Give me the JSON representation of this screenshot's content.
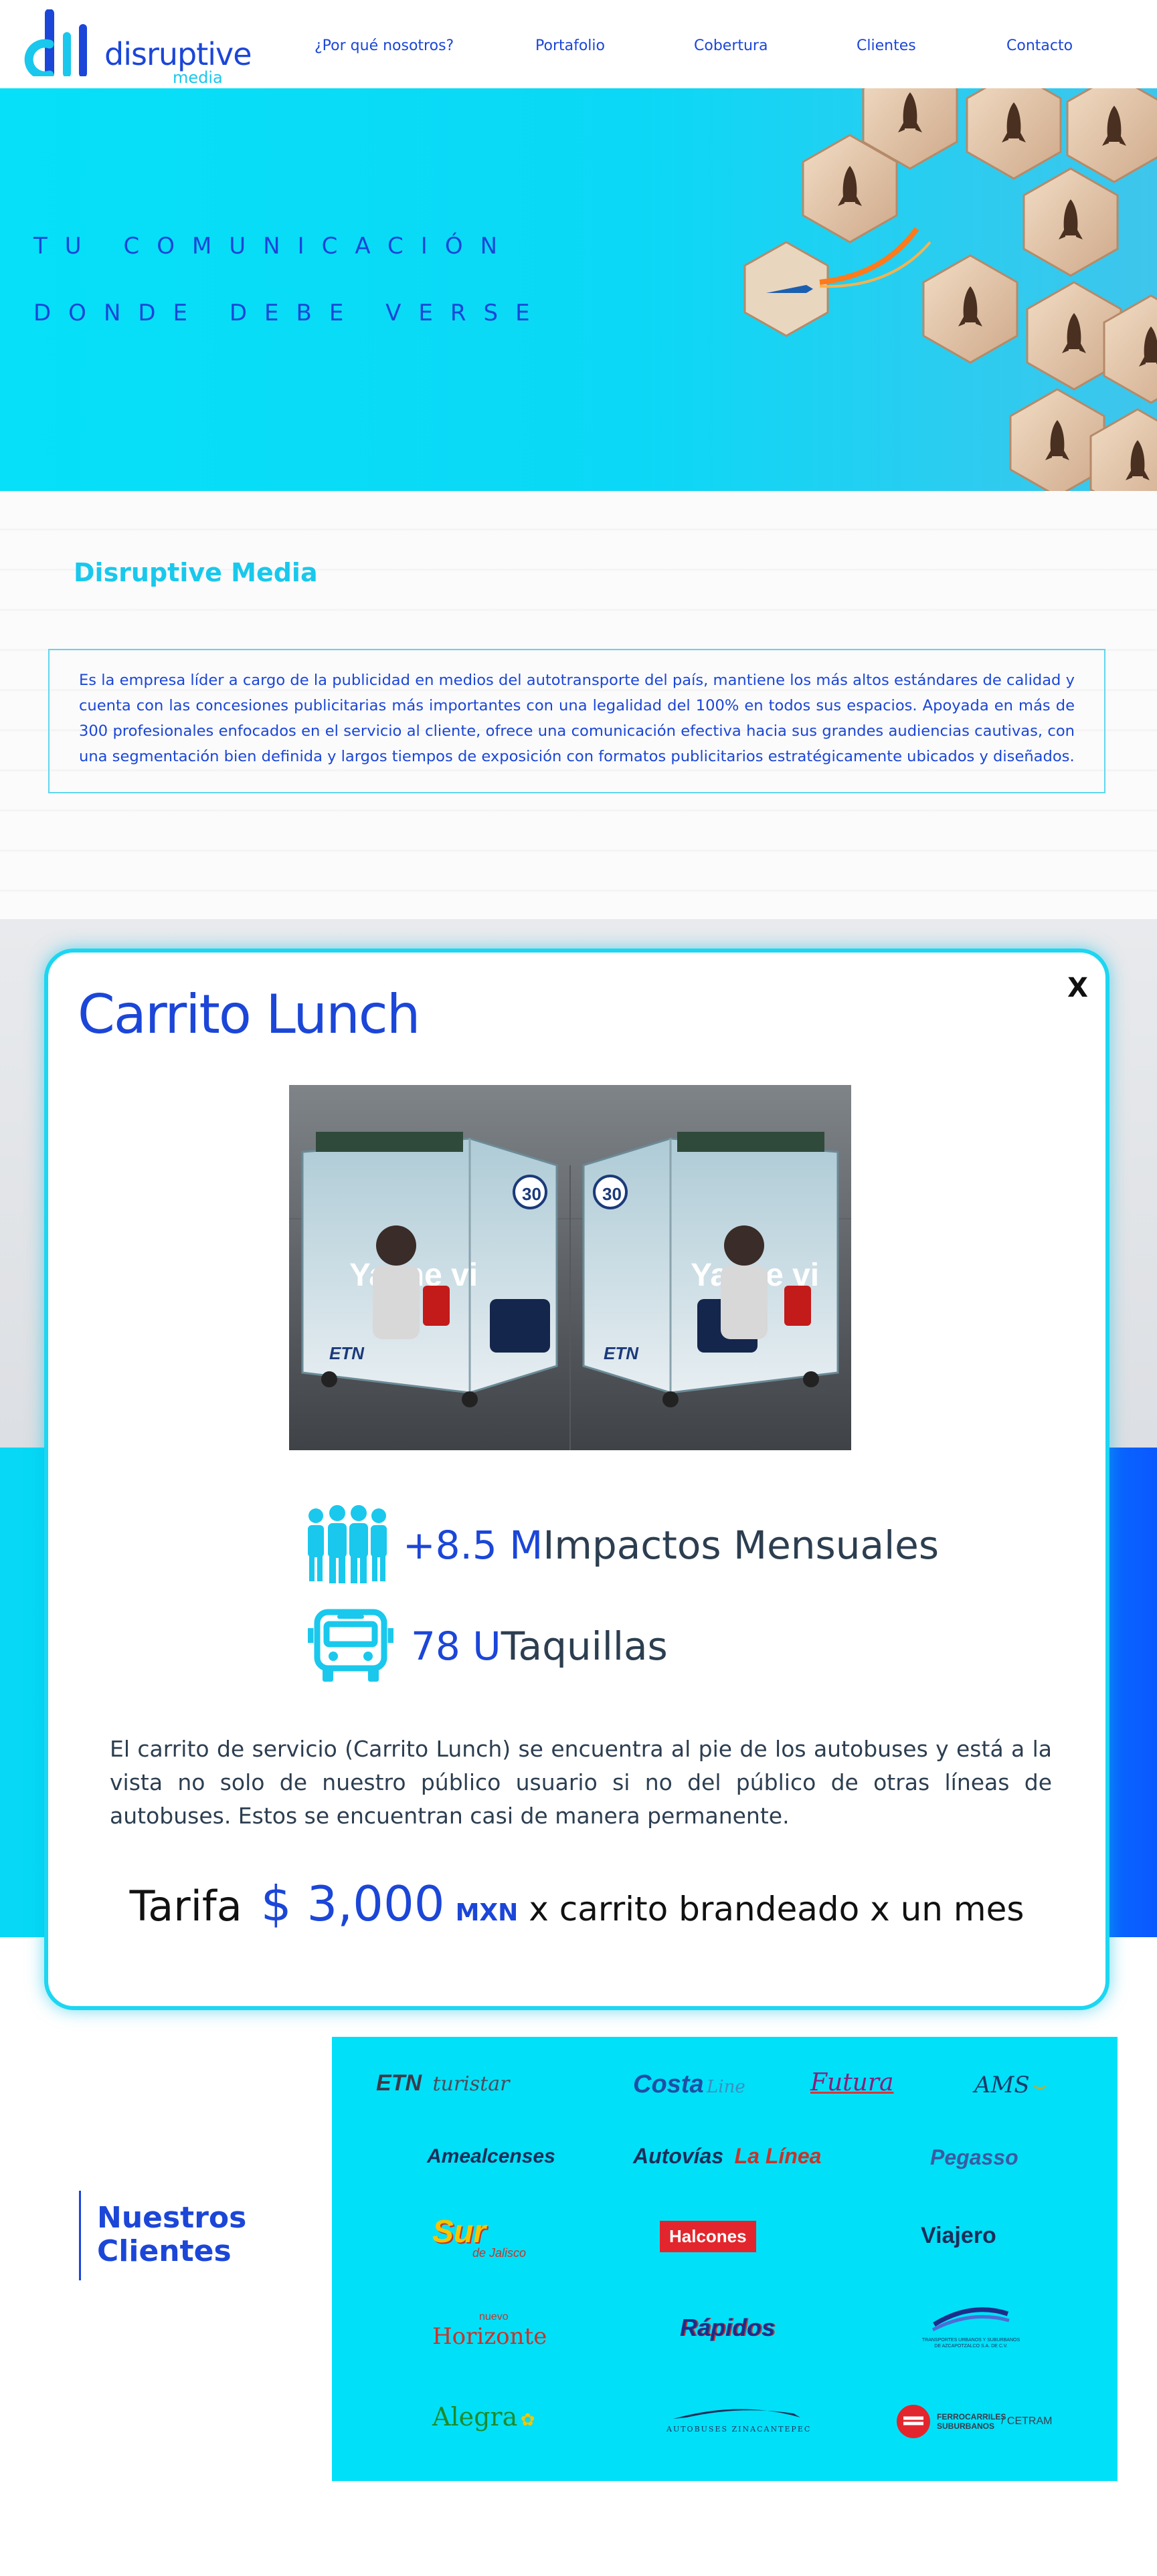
{
  "nav": {
    "logo_text": "disruptive",
    "logo_sub": "media",
    "items": [
      "¿Por qué nosotros?",
      "Portafolio",
      "Cobertura",
      "Clientes",
      "Contacto"
    ]
  },
  "hero": {
    "line1": "TU COMUNICACIÓN",
    "line2": "DONDE DEBE VERSE"
  },
  "about": {
    "title": "Disruptive Media",
    "text": "Es la empresa líder a cargo de la publicidad en medios del  autotransporte del país, mantiene los más altos estándares de calidad y cuenta con las concesiones publicitarias más importantes  con una legalidad del 100% en todos sus espacios. Apoyada en más de 300 profesionales enfocados en el servicio al cliente, ofrece una comunicación efectiva hacia sus grandes audiencias cautivas, con una segmentación bien definida y largos tiempos de exposición con formatos publicitarios estratégicamente ubicados y diseñados."
  },
  "modal": {
    "title": "Carrito Lunch",
    "close": "X",
    "photo": {
      "cart_text_1": "Ya me vi",
      "cart_text_2": "Ya me vi",
      "cart_brand": "ETN",
      "badge": "30"
    },
    "stats": [
      {
        "icon": "people-icon",
        "value": "+8.5 M",
        "label": " Impactos Mensuales"
      },
      {
        "icon": "bus-icon",
        "value": "78 U",
        "label": " Taquillas"
      }
    ],
    "description": "El carrito de servicio (Carrito Lunch) se encuentra al pie de los autobuses y está a la vista no solo de nuestro público usuario si no del público de otras líneas de autobuses. Estos se encuentran casi de manera permanente.",
    "price": {
      "label": "Tarifa",
      "amount": "$ 3,000",
      "currency": "MXN",
      "suffix": "x carrito brandeado x un mes"
    }
  },
  "clients": {
    "heading_line1": "Nuestros",
    "heading_line2": "Clientes",
    "logos": {
      "etn": "ETN",
      "turistar": "turistar",
      "costa": "Costa",
      "costa_line": "Line",
      "futura": "Futura",
      "ams": "AMS",
      "amealcenses": "Amealcenses",
      "autovias": "Autovías",
      "la_linea": "La Línea",
      "pegasso": "Pegasso",
      "sur": "Sur",
      "sur_sub": "de Jalisco",
      "halcones": "Halcones",
      "viajero": "Viajero",
      "horizonte_top": "nuevo",
      "horizonte": "Horizonte",
      "rapidos": "Rápidos",
      "transportes": "TRANSPORTES URBANOS Y SUBURBANOS DE AZCAPOTZALCO S.A. DE C.V.",
      "alegra": "Alegra",
      "zinacantepec": "AUTOBUSES ZINACANTEPEC",
      "ferrocarriles": "FERROCARRILES SUBURBANOS",
      "cetram": "/ CETRAM"
    }
  },
  "colors": {
    "brand_blue": "#1b46d8",
    "brand_cyan": "#19c8ec",
    "panel_cyan": "#00e0f8"
  }
}
